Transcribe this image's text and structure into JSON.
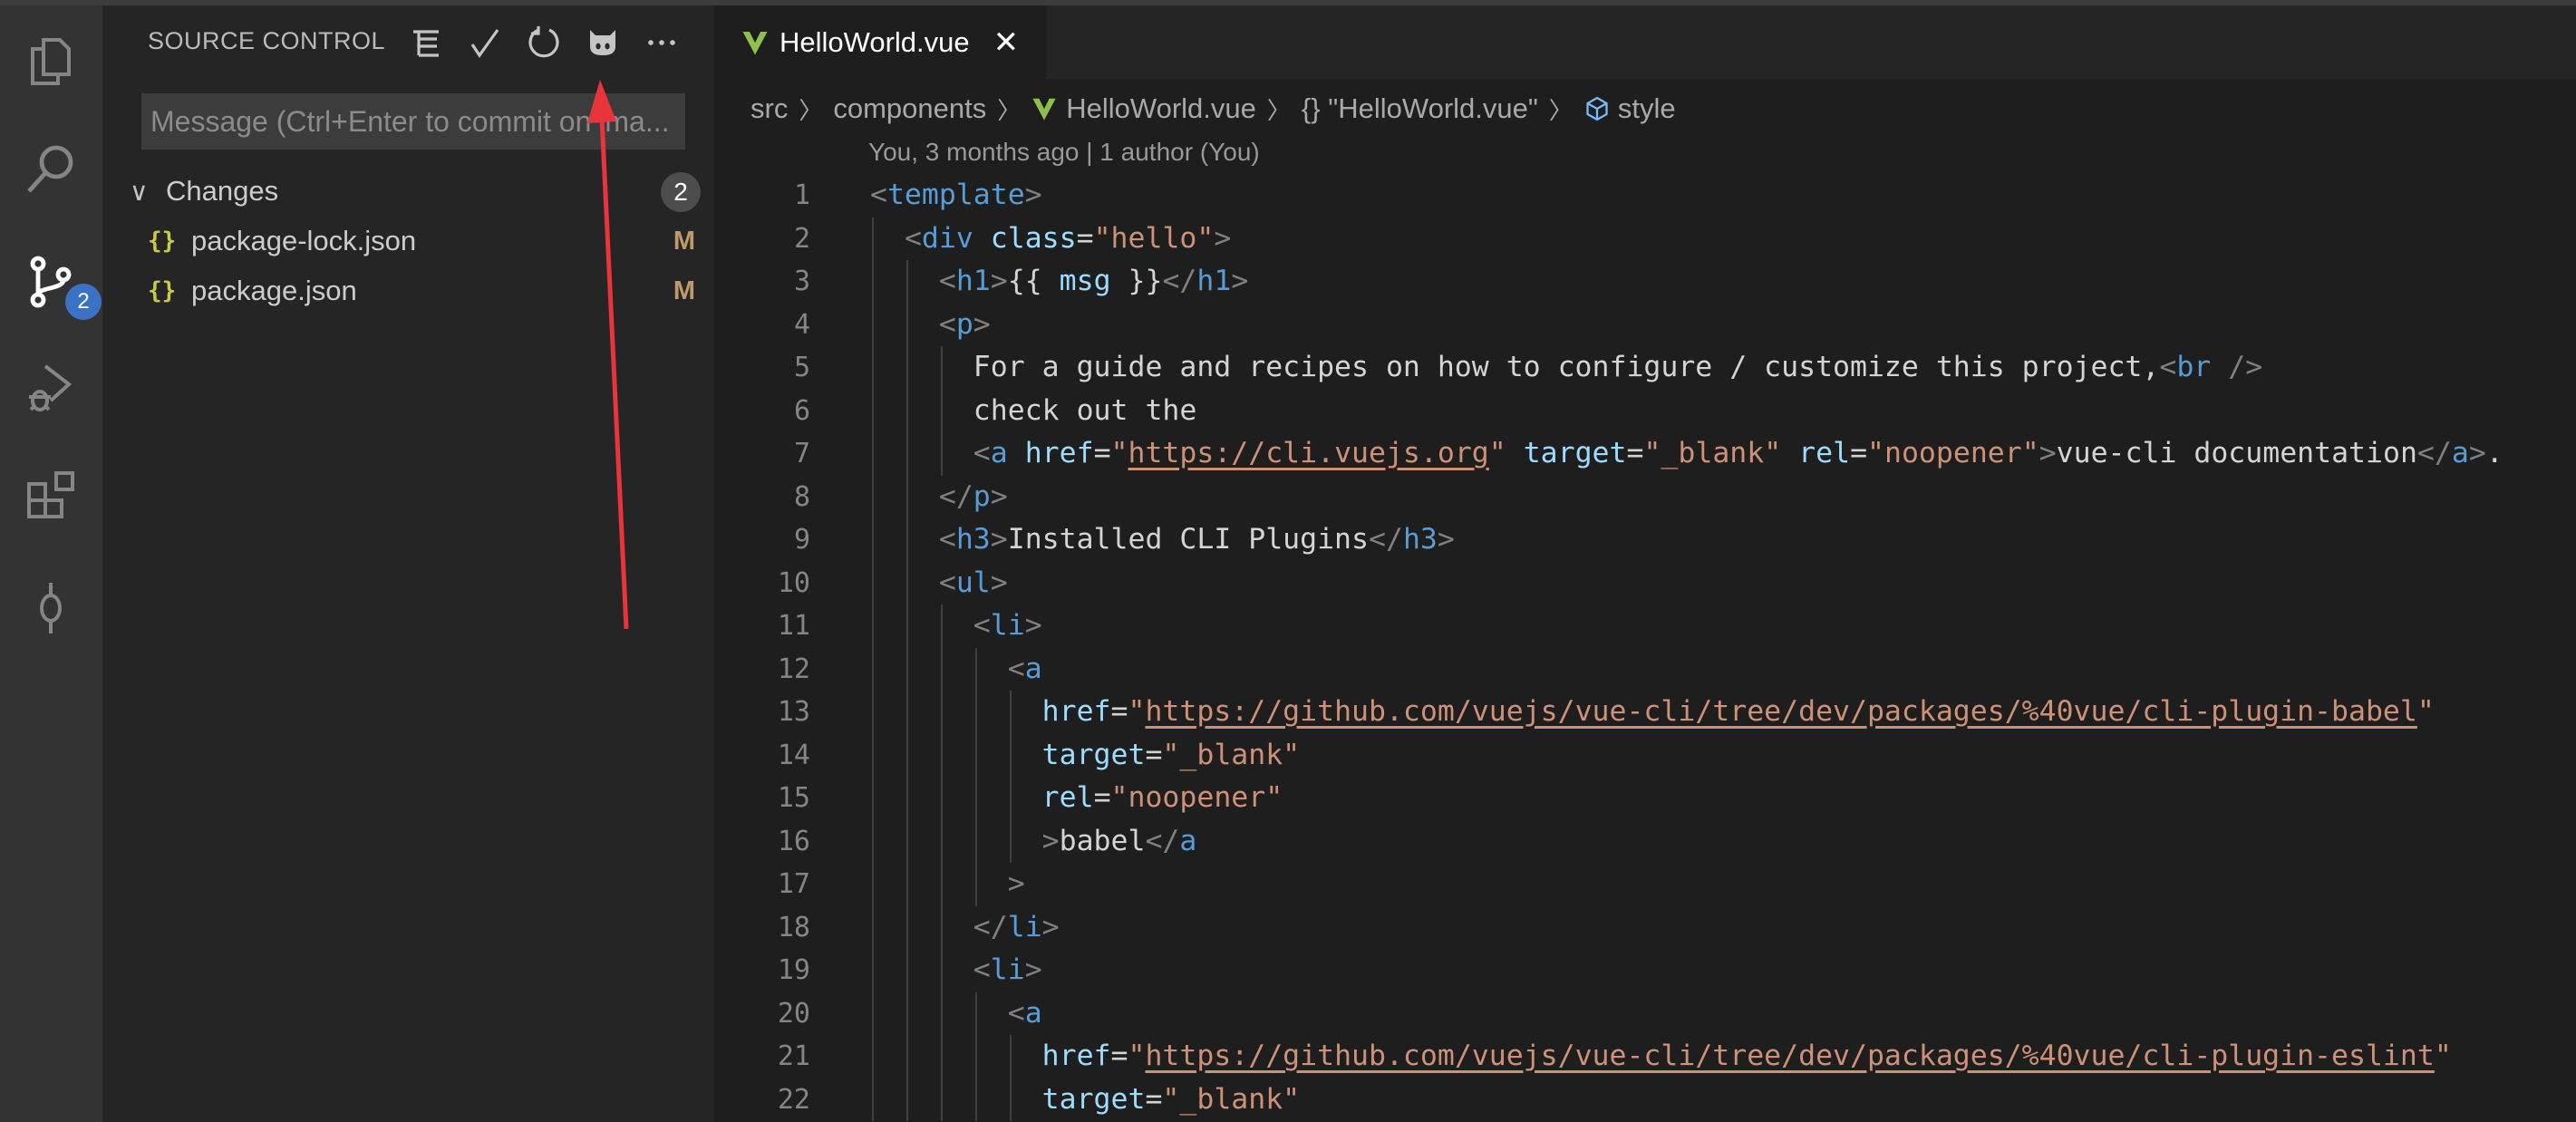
{
  "activity_bar": {
    "scm_badge": "2"
  },
  "sidebar": {
    "title": "SOURCE CONTROL",
    "message_placeholder": "Message (Ctrl+Enter to commit on 'ma...",
    "changes_label": "Changes",
    "changes_count": "2",
    "files": [
      {
        "icon": "{}",
        "name": "package-lock.json",
        "status": "M"
      },
      {
        "icon": "{}",
        "name": "package.json",
        "status": "M"
      }
    ]
  },
  "editor": {
    "tab": {
      "label": "HelloWorld.vue",
      "close": "✕"
    },
    "breadcrumbs": [
      "src",
      "components",
      "HelloWorld.vue",
      "{} \"HelloWorld.vue\"",
      "style"
    ],
    "blame": "You, 3 months ago | 1 author (You)",
    "lines": [
      {
        "n": "1",
        "indent": 0,
        "tokens": [
          [
            "p",
            "<"
          ],
          [
            "t",
            "template"
          ],
          [
            "p",
            ">"
          ]
        ]
      },
      {
        "n": "2",
        "indent": 2,
        "tokens": [
          [
            "p",
            "<"
          ],
          [
            "t",
            "div"
          ],
          [
            "x",
            " "
          ],
          [
            "a",
            "class"
          ],
          [
            "x",
            "="
          ],
          [
            "s",
            "\"hello\""
          ],
          [
            "p",
            ">"
          ]
        ]
      },
      {
        "n": "3",
        "indent": 4,
        "tokens": [
          [
            "p",
            "<"
          ],
          [
            "t",
            "h1"
          ],
          [
            "p",
            ">"
          ],
          [
            "x",
            "{{ "
          ],
          [
            "a",
            "msg"
          ],
          [
            "x",
            " }}"
          ],
          [
            "p",
            "</"
          ],
          [
            "t",
            "h1"
          ],
          [
            "p",
            ">"
          ]
        ]
      },
      {
        "n": "4",
        "indent": 4,
        "tokens": [
          [
            "p",
            "<"
          ],
          [
            "t",
            "p"
          ],
          [
            "p",
            ">"
          ]
        ]
      },
      {
        "n": "5",
        "indent": 6,
        "tokens": [
          [
            "x",
            "For a guide and recipes on how to configure / customize this project,"
          ],
          [
            "p",
            "<"
          ],
          [
            "t",
            "br"
          ],
          [
            "x",
            " "
          ],
          [
            "p",
            "/>"
          ]
        ]
      },
      {
        "n": "6",
        "indent": 6,
        "tokens": [
          [
            "x",
            "check out the"
          ]
        ]
      },
      {
        "n": "7",
        "indent": 6,
        "tokens": [
          [
            "p",
            "<"
          ],
          [
            "t",
            "a"
          ],
          [
            "x",
            " "
          ],
          [
            "a",
            "href"
          ],
          [
            "x",
            "="
          ],
          [
            "s",
            "\""
          ],
          [
            "u",
            "https://cli.vuejs.org"
          ],
          [
            "s",
            "\""
          ],
          [
            "x",
            " "
          ],
          [
            "a",
            "target"
          ],
          [
            "x",
            "="
          ],
          [
            "s",
            "\"_blank\""
          ],
          [
            "x",
            " "
          ],
          [
            "a",
            "rel"
          ],
          [
            "x",
            "="
          ],
          [
            "s",
            "\"noopener\""
          ],
          [
            "p",
            ">"
          ],
          [
            "x",
            "vue-cli documentation"
          ],
          [
            "p",
            "</"
          ],
          [
            "t",
            "a"
          ],
          [
            "p",
            ">"
          ],
          [
            "x",
            "."
          ]
        ]
      },
      {
        "n": "8",
        "indent": 4,
        "tokens": [
          [
            "p",
            "</"
          ],
          [
            "t",
            "p"
          ],
          [
            "p",
            ">"
          ]
        ]
      },
      {
        "n": "9",
        "indent": 4,
        "tokens": [
          [
            "p",
            "<"
          ],
          [
            "t",
            "h3"
          ],
          [
            "p",
            ">"
          ],
          [
            "x",
            "Installed CLI Plugins"
          ],
          [
            "p",
            "</"
          ],
          [
            "t",
            "h3"
          ],
          [
            "p",
            ">"
          ]
        ]
      },
      {
        "n": "10",
        "indent": 4,
        "tokens": [
          [
            "p",
            "<"
          ],
          [
            "t",
            "ul"
          ],
          [
            "p",
            ">"
          ]
        ]
      },
      {
        "n": "11",
        "indent": 6,
        "tokens": [
          [
            "p",
            "<"
          ],
          [
            "t",
            "li"
          ],
          [
            "p",
            ">"
          ]
        ]
      },
      {
        "n": "12",
        "indent": 8,
        "tokens": [
          [
            "p",
            "<"
          ],
          [
            "t",
            "a"
          ]
        ]
      },
      {
        "n": "13",
        "indent": 10,
        "tokens": [
          [
            "a",
            "href"
          ],
          [
            "x",
            "="
          ],
          [
            "s",
            "\""
          ],
          [
            "u",
            "https://github.com/vuejs/vue-cli/tree/dev/packages/%40vue/cli-plugin-babel"
          ],
          [
            "s",
            "\""
          ]
        ]
      },
      {
        "n": "14",
        "indent": 10,
        "tokens": [
          [
            "a",
            "target"
          ],
          [
            "x",
            "="
          ],
          [
            "s",
            "\"_blank\""
          ]
        ]
      },
      {
        "n": "15",
        "indent": 10,
        "tokens": [
          [
            "a",
            "rel"
          ],
          [
            "x",
            "="
          ],
          [
            "s",
            "\"noopener\""
          ]
        ]
      },
      {
        "n": "16",
        "indent": 10,
        "tokens": [
          [
            "p",
            ">"
          ],
          [
            "x",
            "babel"
          ],
          [
            "p",
            "</"
          ],
          [
            "t",
            "a"
          ]
        ]
      },
      {
        "n": "17",
        "indent": 8,
        "tokens": [
          [
            "p",
            ">"
          ]
        ]
      },
      {
        "n": "18",
        "indent": 6,
        "tokens": [
          [
            "p",
            "</"
          ],
          [
            "t",
            "li"
          ],
          [
            "p",
            ">"
          ]
        ]
      },
      {
        "n": "19",
        "indent": 6,
        "tokens": [
          [
            "p",
            "<"
          ],
          [
            "t",
            "li"
          ],
          [
            "p",
            ">"
          ]
        ]
      },
      {
        "n": "20",
        "indent": 8,
        "tokens": [
          [
            "p",
            "<"
          ],
          [
            "t",
            "a"
          ]
        ]
      },
      {
        "n": "21",
        "indent": 10,
        "tokens": [
          [
            "a",
            "href"
          ],
          [
            "x",
            "="
          ],
          [
            "s",
            "\""
          ],
          [
            "u",
            "https://github.com/vuejs/vue-cli/tree/dev/packages/%40vue/cli-plugin-eslint"
          ],
          [
            "s",
            "\""
          ]
        ]
      },
      {
        "n": "22",
        "indent": 10,
        "tokens": [
          [
            "a",
            "target"
          ],
          [
            "x",
            "="
          ],
          [
            "s",
            "\"_blank\""
          ]
        ]
      }
    ]
  },
  "colors": {
    "accent_badge": "#3a72c6",
    "vue_green": "#8dc149",
    "annotation_arrow": "#e8343a"
  }
}
